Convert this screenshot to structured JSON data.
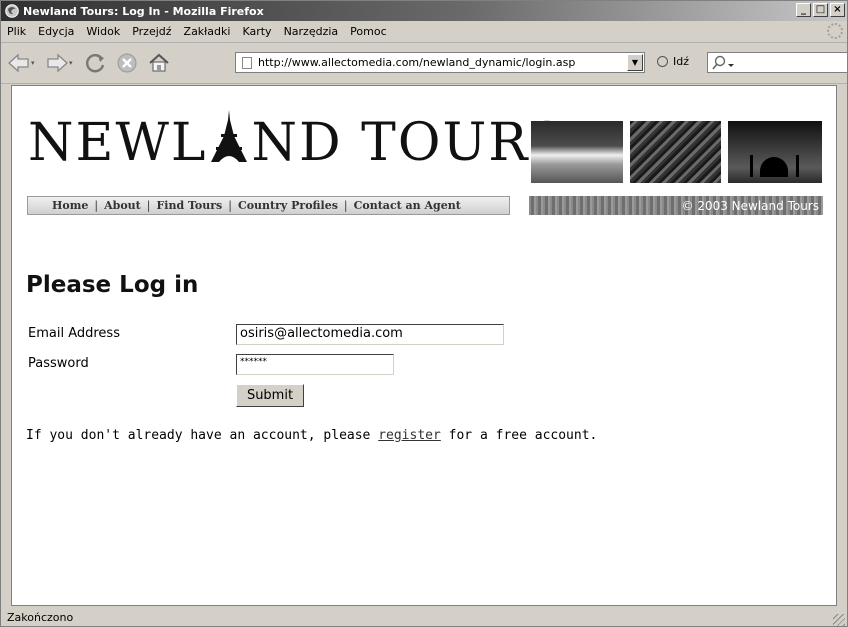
{
  "window": {
    "title": "Newland Tours: Log In - Mozilla Firefox",
    "buttons": [
      "_",
      "□",
      "×"
    ]
  },
  "menu": {
    "items": [
      "Plik",
      "Edycja",
      "Widok",
      "Przejdź",
      "Zakładki",
      "Karty",
      "Narzędzia",
      "Pomoc"
    ]
  },
  "toolbar": {
    "url": "http://www.allectomedia.com/newland_dynamic/login.asp",
    "go_label": "Idź",
    "search_value": ""
  },
  "site": {
    "logo_left": "NEWL",
    "logo_right": "ND TOURS",
    "nav": [
      "Home",
      "About",
      "Find Tours",
      "Country Profiles",
      "Contact an Agent"
    ],
    "nav_separator": "|",
    "copyright": "© 2003 Newland Tours"
  },
  "login": {
    "heading": "Please Log in",
    "email_label": "Email Address",
    "email_value": "osiris@allectomedia.com",
    "password_label": "Password",
    "password_mask": "******",
    "submit_label": "Submit",
    "info_before": "If you don't already have an account, please ",
    "register_link": "register",
    "info_after": " for a free account."
  },
  "status": {
    "text": "Zakończono"
  },
  "colors": {
    "titlebar_dark": "#303030",
    "chrome": "#d4d0c8",
    "page_bg": "#ffffff"
  }
}
